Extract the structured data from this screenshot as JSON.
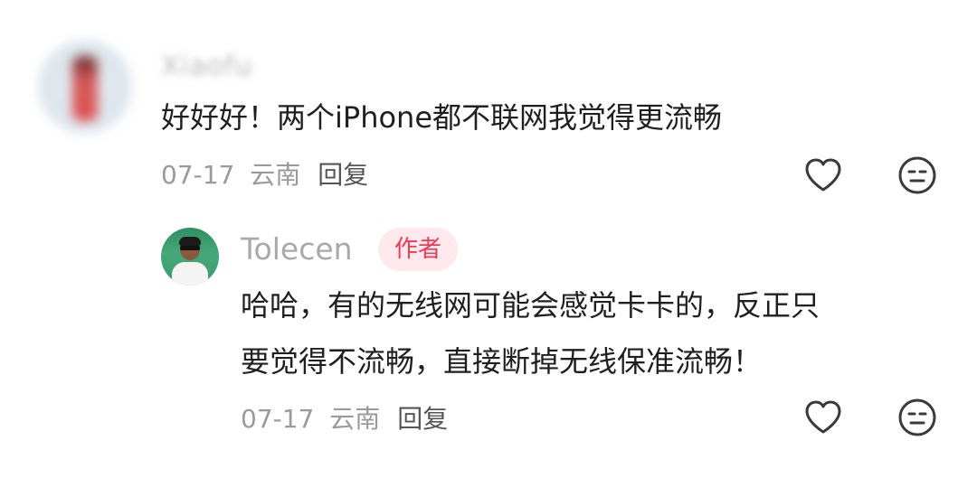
{
  "comments": [
    {
      "username": "Xiaofu",
      "text": "好好好！两个iPhone都不联网我觉得更流畅",
      "date": "07-17",
      "location": "云南",
      "reply_label": "回复"
    }
  ],
  "reply": {
    "username": "Tolecen",
    "badge": "作者",
    "text_line1": "哈哈，有的无线网可能会感觉卡卡的，反正只",
    "text_line2": "要觉得不流畅，直接断掉无线保准流畅！",
    "date": "07-17",
    "location": "云南",
    "reply_label": "回复"
  },
  "icons": {
    "like": "heart-outline-icon",
    "dislike": "neutral-face-icon"
  },
  "colors": {
    "badge_text": "#ee3a54",
    "badge_bg": "#ffe9ec",
    "meta_gray": "#9a9a9a"
  }
}
